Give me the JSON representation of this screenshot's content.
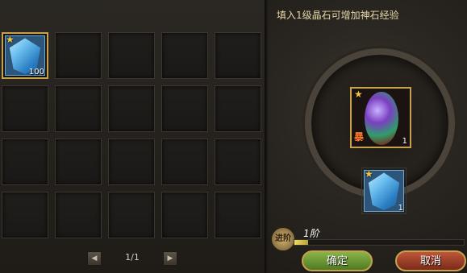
{
  "hint_text": "填入1级晶石可增加神石经验",
  "inventory": {
    "slots": [
      {
        "item": "blue-diamond",
        "count": "100",
        "star": true,
        "selected": true
      },
      {},
      {},
      {},
      {},
      {},
      {},
      {},
      {},
      {},
      {},
      {},
      {},
      {},
      {},
      {},
      {},
      {},
      {},
      {}
    ]
  },
  "pager": {
    "text": "1/1",
    "prev": "◀",
    "next": "▶"
  },
  "main_slot": {
    "item": "god-stone",
    "count": "1",
    "star": true,
    "tag": "暴"
  },
  "sub_slot": {
    "item": "blue-diamond",
    "count": "1",
    "star": true
  },
  "rank": {
    "icon_text": "进阶",
    "label": "1阶",
    "progress": 0.08
  },
  "buttons": {
    "ok": "确定",
    "cancel": "取消"
  }
}
